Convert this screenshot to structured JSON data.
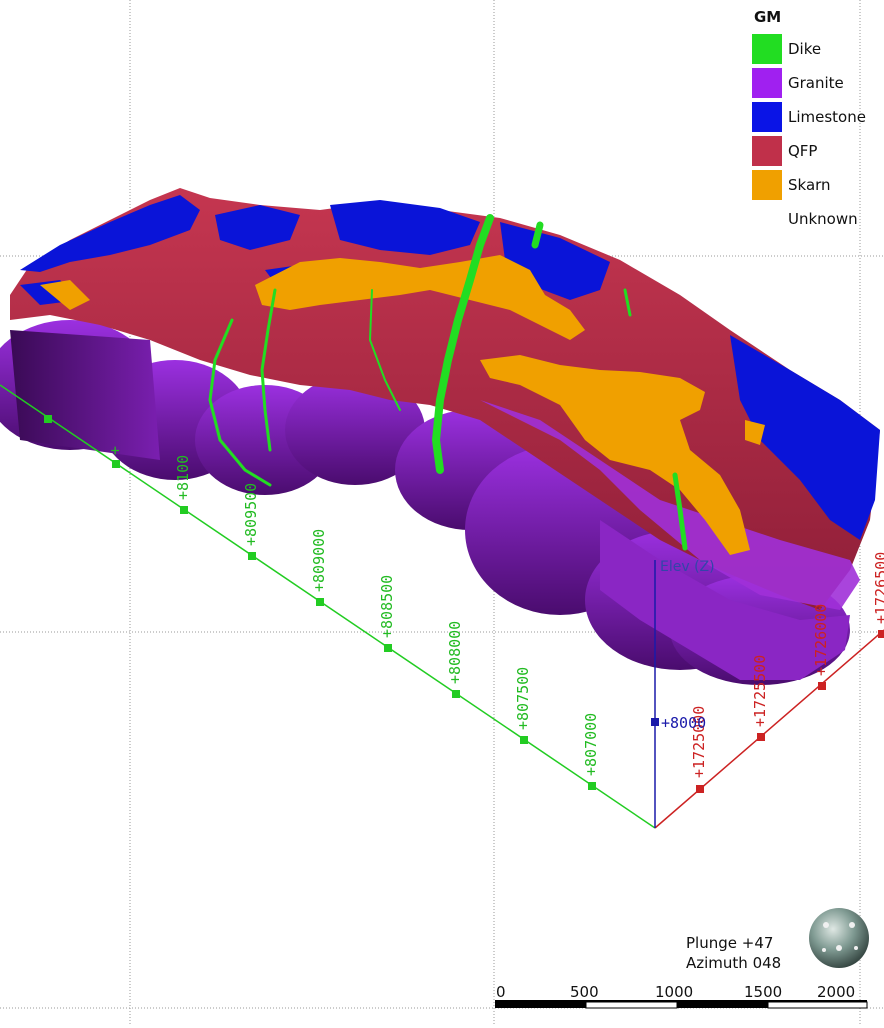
{
  "legend": {
    "title": "GM",
    "items": [
      {
        "label": "Dike",
        "color": "#22dd22"
      },
      {
        "label": "Granite",
        "color": "#a020f0"
      },
      {
        "label": "Limestone",
        "color": "#0a14e6"
      },
      {
        "label": "QFP",
        "color": "#c0304a"
      },
      {
        "label": "Skarn",
        "color": "#f0a000"
      },
      {
        "label": "Unknown",
        "color": ""
      }
    ]
  },
  "axes": {
    "green_color": "#22cc22",
    "red_color": "#cc2222",
    "blue_color": "#1a1aaa",
    "green_ticks": [
      "+8100",
      "+809500",
      "+809000",
      "+808500",
      "+808000",
      "+807500",
      "+807000"
    ],
    "red_ticks": [
      "+1725000",
      "+1725500",
      "+1726000",
      "+1726500"
    ],
    "blue_tick": "+8000",
    "elev_label": "Elev (Z)"
  },
  "orientation": {
    "plunge": "Plunge +47",
    "azimuth": "Azimuth 048"
  },
  "scale_bar": {
    "labels": [
      "0",
      "500",
      "1000",
      "1500",
      "2000"
    ]
  }
}
